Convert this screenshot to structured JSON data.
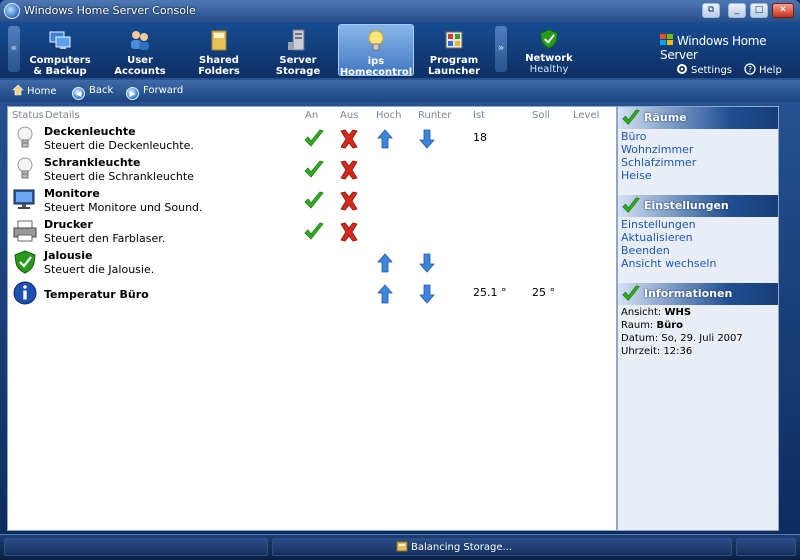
{
  "window": {
    "title": "Windows Home Server Console"
  },
  "nav": {
    "tabs": [
      {
        "line1": "Computers",
        "line2": "& Backup",
        "icon": "computers-icon"
      },
      {
        "line1": "User",
        "line2": "Accounts",
        "icon": "users-icon"
      },
      {
        "line1": "Shared",
        "line2": "Folders",
        "icon": "folder-icon"
      },
      {
        "line1": "Server",
        "line2": "Storage",
        "icon": "server-icon"
      },
      {
        "line1": "ips",
        "line2": "Homecontrol",
        "icon": "lightbulb-icon",
        "active": true
      },
      {
        "line1": "Program",
        "line2": "Launcher",
        "icon": "launcher-icon"
      }
    ],
    "network": {
      "label": "Network",
      "status": "Healthy"
    },
    "brand": "Windows Home Server",
    "settings": "Settings",
    "help": "Help"
  },
  "toolbar": {
    "home": "Home",
    "back": "Back",
    "forward": "Forward"
  },
  "table": {
    "headers": {
      "status": "Status",
      "details": "Details",
      "on": "An",
      "off": "Aus",
      "up": "Hoch",
      "down": "Runter",
      "actual": "Ist",
      "target": "Soll",
      "level": "Level"
    },
    "rows": [
      {
        "name": "Deckenleuchte",
        "desc": "Steuert die Deckenleuchte.",
        "icon": "bulb-icon",
        "on": true,
        "off": true,
        "up": true,
        "down": true,
        "actual": "18",
        "target": ""
      },
      {
        "name": "Schrankleuchte",
        "desc": "Steuert die Schrankleuchte",
        "icon": "bulb-icon",
        "on": true,
        "off": true
      },
      {
        "name": "Monitore",
        "desc": "Steuert Monitore und Sound.",
        "icon": "monitor-icon",
        "on": true,
        "off": true
      },
      {
        "name": "Drucker",
        "desc": "Steuert den Farblaser.",
        "icon": "printer-icon",
        "on": true,
        "off": true
      },
      {
        "name": "Jalousie",
        "desc": "Steuert die Jalousie.",
        "icon": "shield-icon",
        "up": true,
        "down": true
      },
      {
        "name": "Temperatur Büro",
        "desc": "",
        "icon": "info-icon",
        "up": true,
        "down": true,
        "actual": "25.1 °",
        "target": "25 °"
      }
    ]
  },
  "side": {
    "rooms": {
      "title": "Räume",
      "items": [
        "Büro",
        "Wohnzimmer",
        "Schlafzimmer",
        "Heise"
      ]
    },
    "settings": {
      "title": "Einstellungen",
      "items": [
        "Einstellungen",
        "Aktualisieren",
        "Beenden",
        "Ansicht wechseln"
      ]
    },
    "info": {
      "title": "Informationen",
      "view_label": "Ansicht:",
      "view_value": "WHS",
      "room_label": "Raum:",
      "room_value": "Büro",
      "date_label": "Datum:",
      "date_value": "So, 29. Juli 2007",
      "time_label": "Uhrzeit:",
      "time_value": "12:36"
    }
  },
  "status": {
    "text": "Balancing Storage..."
  },
  "colors": {
    "accent": "#1f4f92",
    "link": "#1a56b4",
    "check": "#2fae1f",
    "cross": "#d42a1b",
    "arrow": "#3f86db"
  }
}
